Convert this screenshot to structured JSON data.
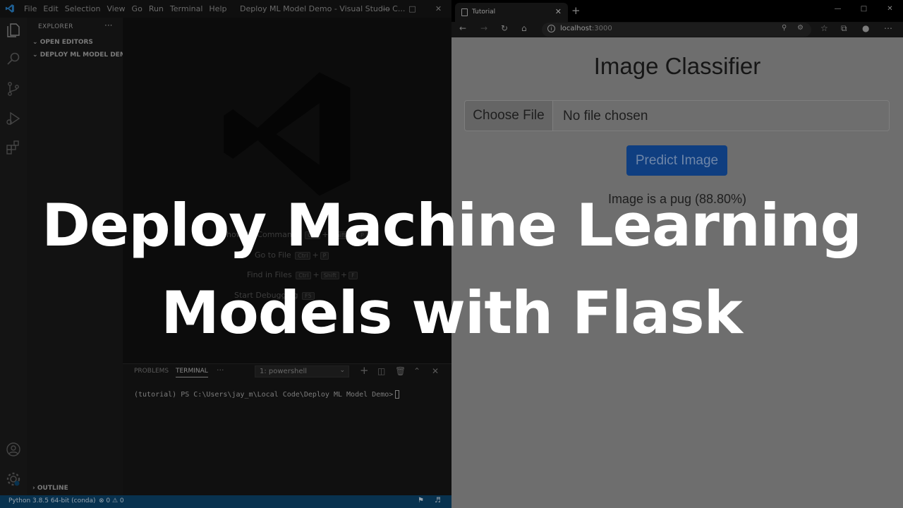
{
  "vscode": {
    "menu": [
      "File",
      "Edit",
      "Selection",
      "View",
      "Go",
      "Run",
      "Terminal",
      "Help"
    ],
    "window_title": "Deploy ML Model Demo - Visual Studio C...",
    "explorer_label": "EXPLORER",
    "explorer_more": "···",
    "open_editors": "OPEN EDITORS",
    "folder": "DEPLOY ML MODEL DEMO",
    "outline": "OUTLINE",
    "shortcuts": [
      {
        "label": "Show All Commands",
        "keys": [
          "Ctrl",
          "+",
          "Shift",
          "+",
          "P"
        ]
      },
      {
        "label": "Go to File",
        "keys": [
          "Ctrl",
          "+",
          "P"
        ]
      },
      {
        "label": "Find in Files",
        "keys": [
          "Ctrl",
          "+",
          "Shift",
          "+",
          "F"
        ]
      },
      {
        "label": "Start Debugging",
        "keys": [
          "F5"
        ]
      }
    ],
    "panel": {
      "tab_problems": "PROBLEMS",
      "tab_terminal": "TERMINAL",
      "tab_more": "···",
      "terminal_select": "1: powershell",
      "prompt": "(tutorial) PS C:\\Users\\jay_m\\Local Code\\Deploy ML Model Demo>"
    },
    "status": {
      "python": "Python 3.8.5 64-bit (conda)",
      "errors": "⊗ 0  ⚠ 0"
    }
  },
  "browser": {
    "tab_title": "Tutorial",
    "address_host": "localhost",
    "address_port": ":3000",
    "page": {
      "title": "Image Classifier",
      "choose_file": "Choose File",
      "file_status": "No file chosen",
      "predict_button": "Predict Image",
      "result": "Image is a pug (88.80%)"
    }
  },
  "overlay": {
    "line1": "Deploy Machine Learning",
    "line2": "Models with Flask"
  }
}
